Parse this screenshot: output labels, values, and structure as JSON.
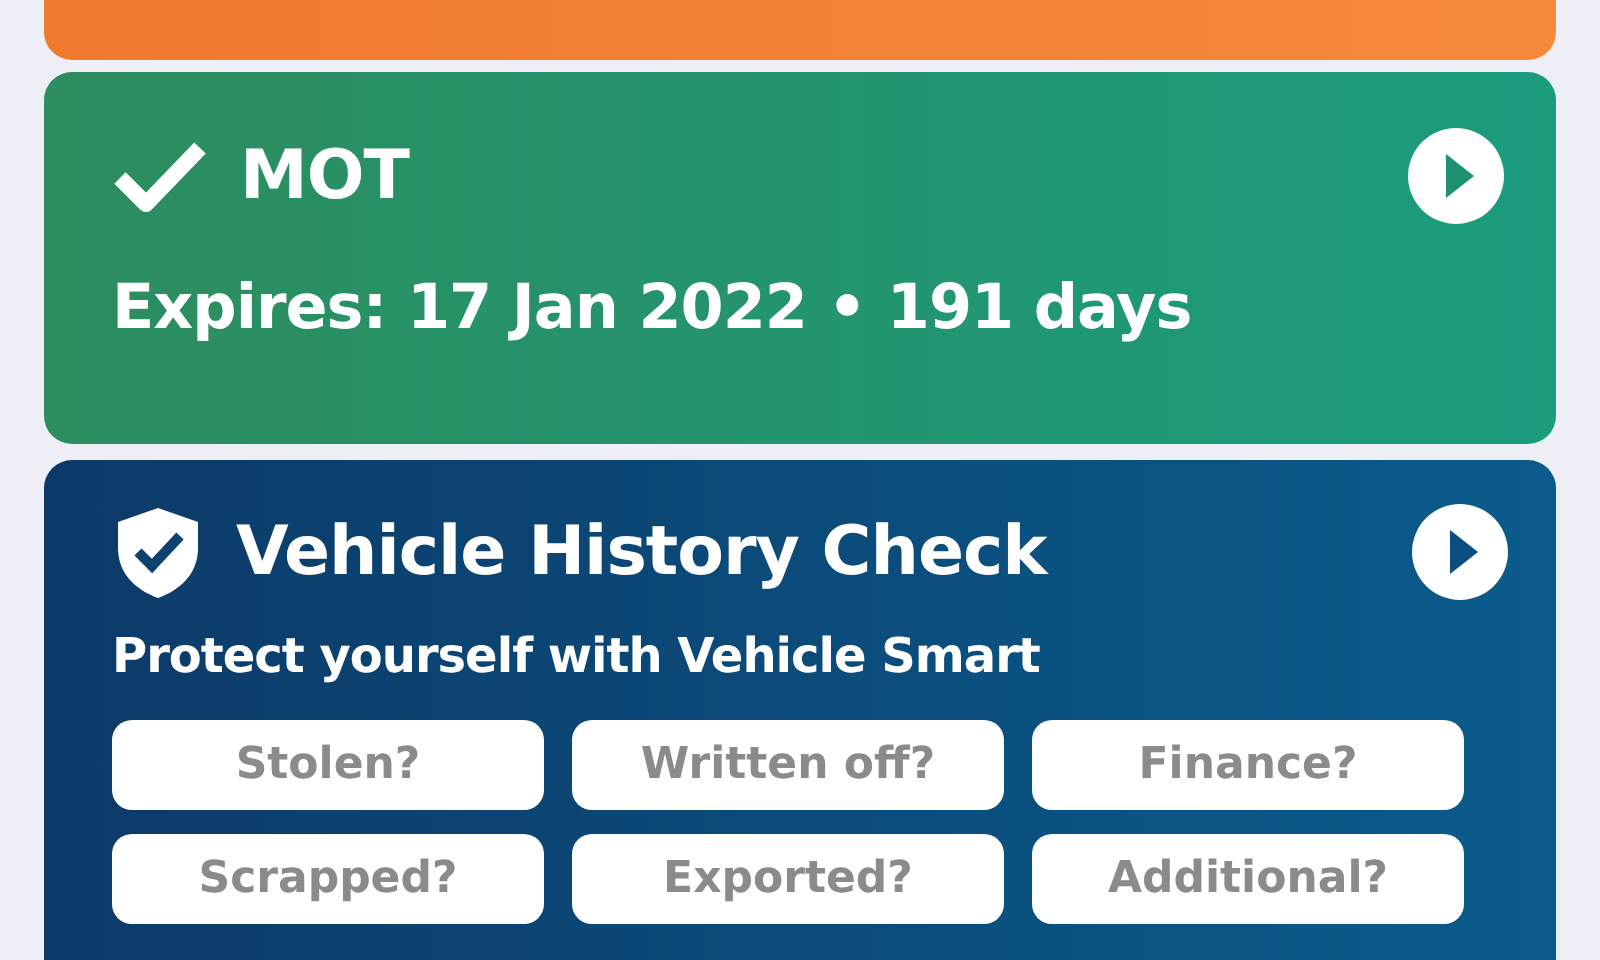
{
  "mot_card": {
    "title": "MOT",
    "detail": "Expires: 17 Jan 2022 • 191 days"
  },
  "history_card": {
    "title": "Vehicle History Check",
    "subtitle": "Protect yourself with Vehicle Smart",
    "checks": [
      "Stolen?",
      "Written off?",
      "Finance?",
      "Scrapped?",
      "Exported?",
      "Additional?"
    ]
  }
}
